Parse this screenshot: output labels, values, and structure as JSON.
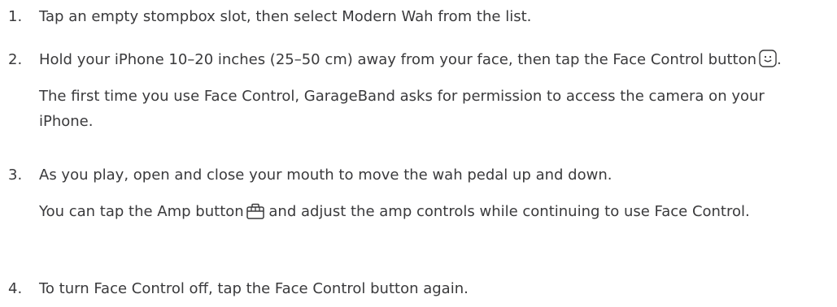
{
  "steps": [
    {
      "number": "1.",
      "text": "Tap an empty stompbox slot, then select Modern Wah from the list."
    },
    {
      "number": "2.",
      "text_before_icon": "Hold your iPhone 10–20 inches (25–50 cm) away from your face, then tap the Face Control button",
      "icon": "face-control-icon",
      "text_after_icon": ".",
      "note": "The first time you use Face Control, GarageBand asks for permission to access the camera on your iPhone."
    },
    {
      "number": "3.",
      "text": "As you play, open and close your mouth to move the wah pedal up and down.",
      "note_before_icon": "You can tap the Amp button",
      "icon": "amp-icon",
      "note_after_icon": " and adjust the amp controls while continuing to use Face Control."
    },
    {
      "number": "4.",
      "text": "To turn Face Control off, tap the Face Control button again."
    }
  ]
}
